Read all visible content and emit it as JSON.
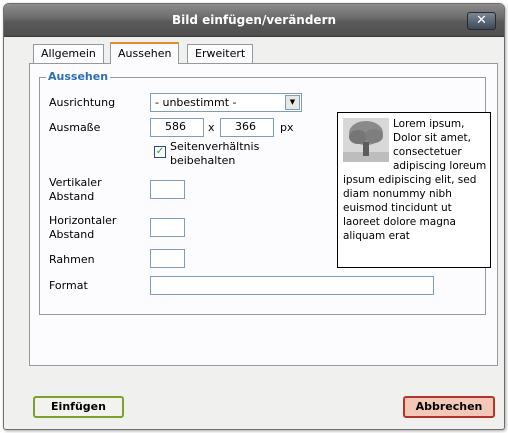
{
  "window": {
    "title": "Bild einfügen/verändern",
    "close": "✕"
  },
  "tabs": [
    {
      "label": "Allgemein"
    },
    {
      "label": "Aussehen"
    },
    {
      "label": "Erweitert"
    }
  ],
  "fieldset": {
    "legend": "Aussehen"
  },
  "fields": {
    "alignment": {
      "label": "Ausrichtung",
      "value": "- unbestimmt -"
    },
    "dimensions": {
      "label": "Ausmaße",
      "width": "586",
      "height": "366",
      "separator": "x",
      "unit": "px"
    },
    "constrain": {
      "label_line1": "Seitenverhältnis",
      "label_line2": "beibehalten",
      "checked": true,
      "check_glyph": "✓"
    },
    "vspace": {
      "label_line1": "Vertikaler",
      "label_line2": "Abstand",
      "value": ""
    },
    "hspace": {
      "label_line1": "Horizontaler",
      "label_line2": "Abstand",
      "value": ""
    },
    "border": {
      "label": "Rahmen",
      "value": ""
    },
    "style": {
      "label": "Format",
      "value": ""
    }
  },
  "preview": {
    "text": "Lorem ipsum, Dolor sit amet, consectetuer adipiscing loreum ipsum edipiscing elit, sed diam nonummy nibh euismod tincidunt ut laoreet dolore magna aliquam erat"
  },
  "buttons": {
    "insert": "Einfügen",
    "cancel": "Abbrechen"
  },
  "colors": {
    "legend": "#2b6fb6",
    "active_tab_accent": "#e68b2c",
    "insert_border": "#7fa02e",
    "cancel_border": "#b3342a",
    "cancel_bg": "#f4c8b8"
  }
}
